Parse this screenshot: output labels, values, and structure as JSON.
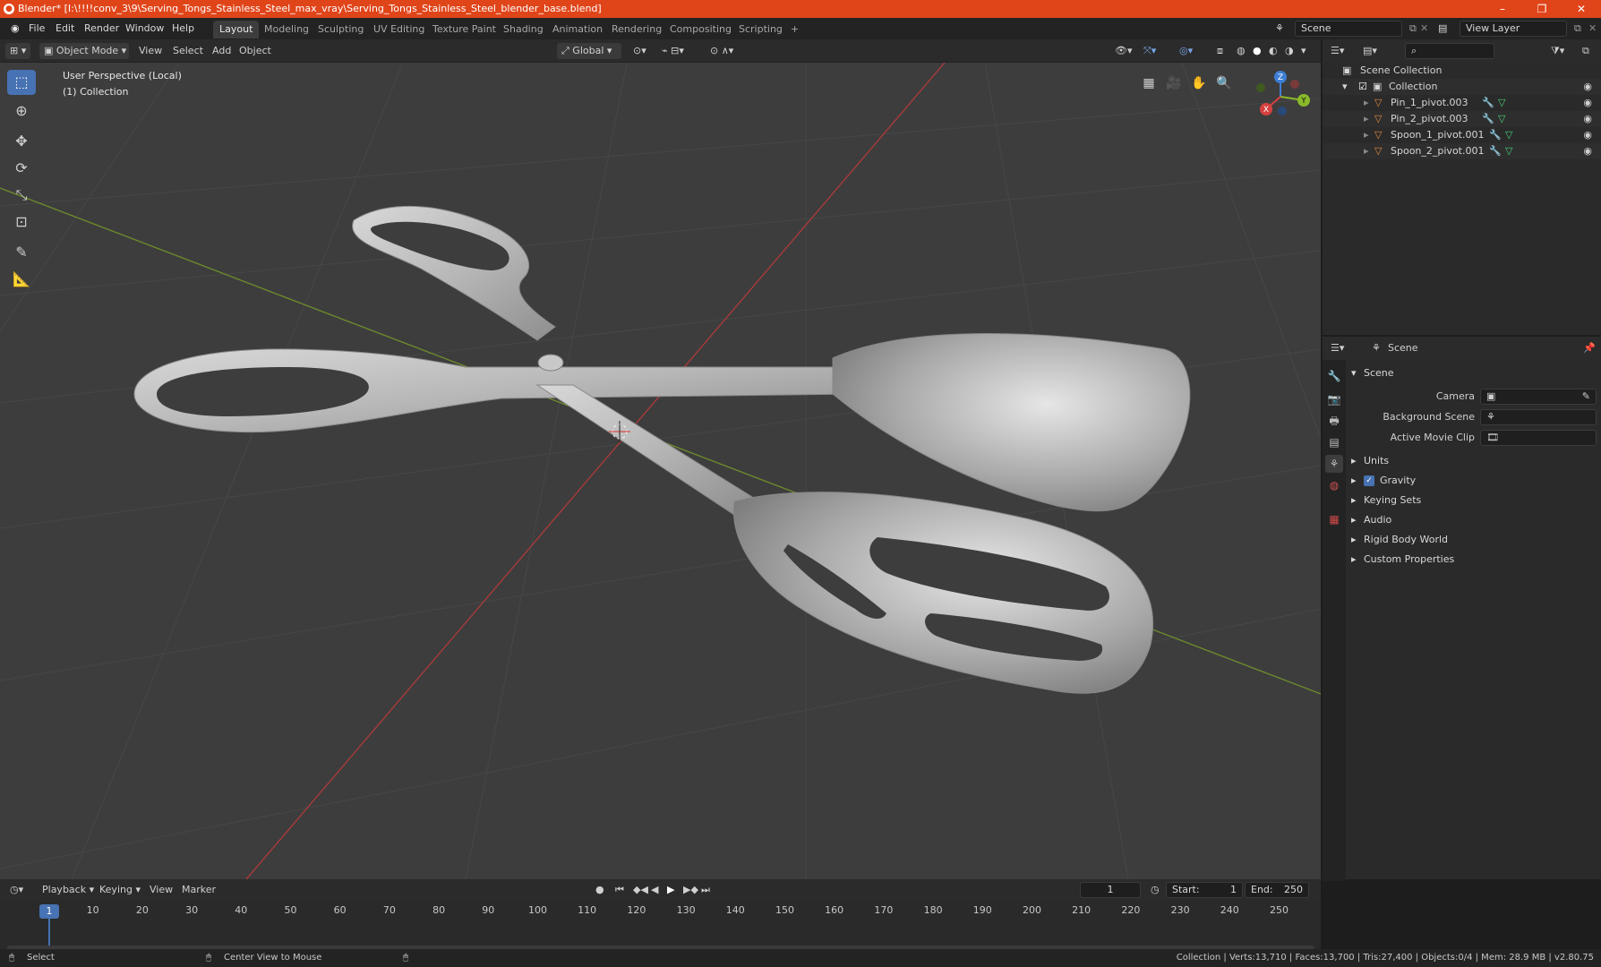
{
  "window": {
    "title": "Blender* [I:\\!!!!conv_3\\9\\Serving_Tongs_Stainless_Steel_max_vray\\Serving_Tongs_Stainless_Steel_blender_base.blend]",
    "minimize": "–",
    "maximize": "❐",
    "close": "✕"
  },
  "menu": [
    "File",
    "Edit",
    "Render",
    "Window",
    "Help"
  ],
  "workspaces": [
    "Layout",
    "Modeling",
    "Sculpting",
    "UV Editing",
    "Texture Paint",
    "Shading",
    "Animation",
    "Rendering",
    "Compositing",
    "Scripting"
  ],
  "workspace_add": "+",
  "scene_field": "Scene",
  "view_layer_field": "View Layer",
  "viewport_header": {
    "mode": "Object Mode",
    "menus": [
      "View",
      "Select",
      "Add",
      "Object"
    ],
    "orientation": "Global"
  },
  "viewport": {
    "perspective": "User Perspective (Local)",
    "collection": "(1) Collection"
  },
  "gizmo": {
    "x": "X",
    "y": "Y",
    "z": "Z"
  },
  "outliner": {
    "root": "Scene Collection",
    "collection": "Collection",
    "items": [
      "Pin_1_pivot.003",
      "Pin_2_pivot.003",
      "Spoon_1_pivot.001",
      "Spoon_2_pivot.001"
    ]
  },
  "properties": {
    "header": "Scene",
    "section": "Scene",
    "fields": [
      {
        "label": "Camera",
        "value": ""
      },
      {
        "label": "Background Scene",
        "value": ""
      },
      {
        "label": "Active Movie Clip",
        "value": ""
      }
    ],
    "panels": [
      "Units",
      "Gravity",
      "Keying Sets",
      "Audio",
      "Rigid Body World",
      "Custom Properties"
    ],
    "gravity_checked": true
  },
  "timeline": {
    "menus": [
      "Playback",
      "Keying",
      "View",
      "Marker"
    ],
    "current_frame": "1",
    "start_label": "Start:",
    "start": "1",
    "end_label": "End:",
    "end": "250",
    "ticks": [
      "1",
      "10",
      "20",
      "30",
      "40",
      "50",
      "60",
      "70",
      "80",
      "90",
      "100",
      "110",
      "120",
      "130",
      "140",
      "150",
      "160",
      "170",
      "180",
      "190",
      "200",
      "210",
      "220",
      "230",
      "240",
      "250"
    ]
  },
  "statusbar": {
    "select": "Select",
    "center_view": "Center View to Mouse",
    "stats": "Collection | Verts:13,710 | Faces:13,700 | Tris:27,400 | Objects:0/4 | Mem: 28.9 MB | v2.80.75"
  },
  "colors": {
    "titlebar": "#e0451a",
    "accent": "#4772b3",
    "axis_x": "#d6413f",
    "axis_y": "#8aba2a",
    "axis_z": "#3d7fd6"
  }
}
